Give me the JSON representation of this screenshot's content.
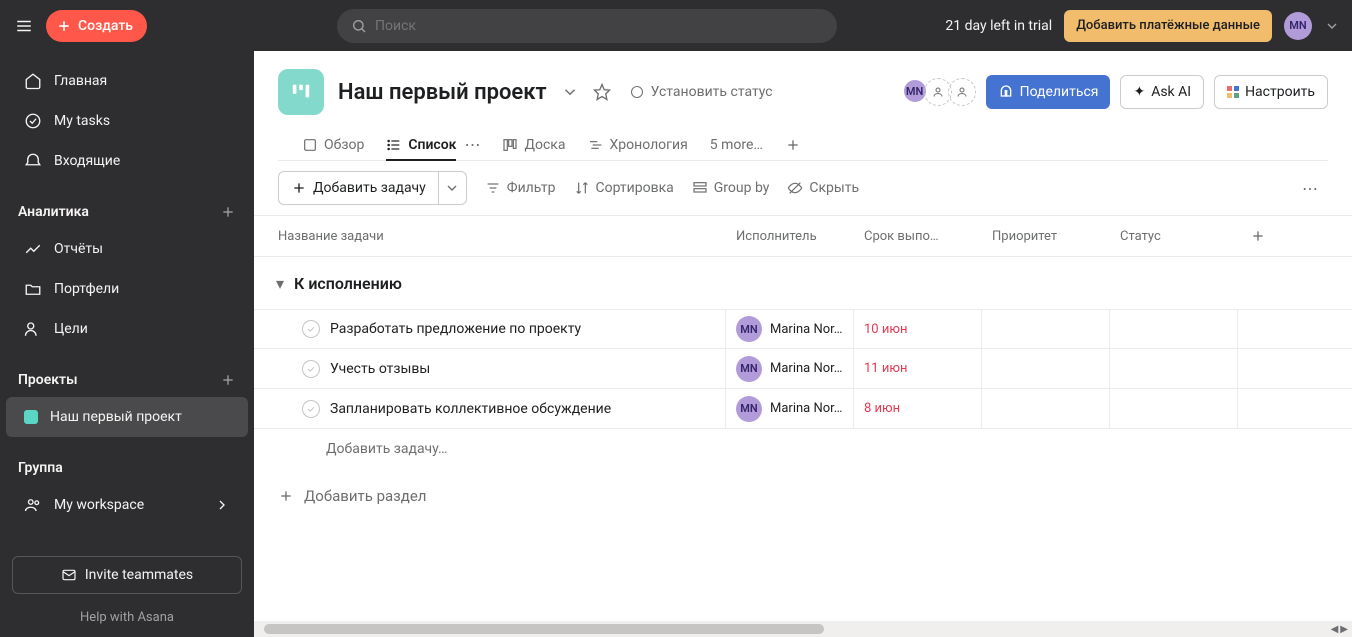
{
  "topbar": {
    "create_label": "Создать",
    "search_placeholder": "Поиск",
    "trial_text": "21 day left in trial",
    "billing_label": "Добавить платёжные данные",
    "avatar_initials": "MN"
  },
  "sidebar": {
    "items": [
      {
        "label": "Главная"
      },
      {
        "label": "My tasks"
      },
      {
        "label": "Входящие"
      }
    ],
    "sections": [
      {
        "title": "Аналитика",
        "items": [
          {
            "label": "Отчёты"
          },
          {
            "label": "Портфели"
          },
          {
            "label": "Цели"
          }
        ]
      },
      {
        "title": "Проекты",
        "items": [
          {
            "label": "Наш первый проект",
            "active": true
          }
        ]
      },
      {
        "title": "Группа",
        "items": [
          {
            "label": "My workspace"
          }
        ]
      }
    ],
    "invite_label": "Invite teammates",
    "help_label": "Help with Asana"
  },
  "project": {
    "title": "Наш первый проект",
    "status_placeholder": "Установить статус",
    "share_label": "Поделиться",
    "ask_ai_label": "Ask AI",
    "customize_label": "Настроить",
    "avatar_initials": "MN"
  },
  "tabs": {
    "overview": "Обзор",
    "list": "Список",
    "board": "Доска",
    "timeline": "Хронология",
    "more": "5 more…"
  },
  "toolbar": {
    "add_task": "Добавить задачу",
    "filter": "Фильтр",
    "sort": "Сортировка",
    "group": "Group by",
    "hide": "Скрыть"
  },
  "columns": {
    "name": "Название задачи",
    "assignee": "Исполнитель",
    "due": "Срок выпо…",
    "priority": "Приоритет",
    "status": "Статус"
  },
  "section": {
    "title": "К исполнению"
  },
  "tasks": [
    {
      "name": "Разработать предложение по проекту",
      "assignee": "Marina Nor…",
      "assignee_initials": "MN",
      "due": "10 июн"
    },
    {
      "name": "Учесть отзывы",
      "assignee": "Marina Nor…",
      "assignee_initials": "MN",
      "due": "11 июн"
    },
    {
      "name": "Запланировать коллективное обсуждение",
      "assignee": "Marina Nor…",
      "assignee_initials": "MN",
      "due": "8 июн"
    }
  ],
  "add_task_placeholder": "Добавить задачу…",
  "add_section_label": "Добавить раздел"
}
